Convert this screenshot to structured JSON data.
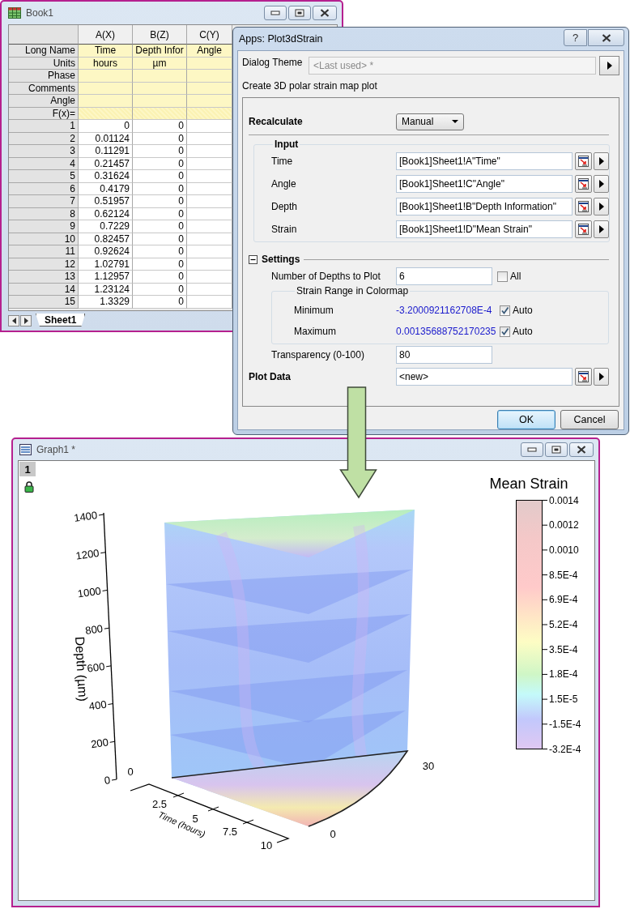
{
  "workbook": {
    "title": "Book1",
    "columns": [
      {
        "header": "A(X)",
        "long_name": "Time",
        "units": "hours"
      },
      {
        "header": "B(Z)",
        "long_name": "Depth Infor",
        "units": "µm"
      },
      {
        "header": "C(Y)",
        "long_name": "Angle"
      }
    ],
    "label_rows": [
      {
        "kind": "long_name",
        "text": "Long Name"
      },
      {
        "kind": "units",
        "text": "Units"
      },
      {
        "kind": "phase",
        "text": "Phase"
      },
      {
        "kind": "comments",
        "text": "Comments"
      },
      {
        "kind": "angle",
        "text": "Angle"
      },
      {
        "kind": "formula",
        "text": "F(x)="
      }
    ],
    "rows": [
      {
        "index": "1",
        "cells": [
          "0",
          "0"
        ]
      },
      {
        "index": "2",
        "cells": [
          "0.01124",
          "0"
        ]
      },
      {
        "index": "3",
        "cells": [
          "0.11291",
          "0"
        ]
      },
      {
        "index": "4",
        "cells": [
          "0.21457",
          "0"
        ]
      },
      {
        "index": "5",
        "cells": [
          "0.31624",
          "0"
        ]
      },
      {
        "index": "6",
        "cells": [
          "0.4179",
          "0"
        ]
      },
      {
        "index": "7",
        "cells": [
          "0.51957",
          "0"
        ]
      },
      {
        "index": "8",
        "cells": [
          "0.62124",
          "0"
        ]
      },
      {
        "index": "9",
        "cells": [
          "0.7229",
          "0"
        ]
      },
      {
        "index": "10",
        "cells": [
          "0.82457",
          "0"
        ]
      },
      {
        "index": "11",
        "cells": [
          "0.92624",
          "0"
        ]
      },
      {
        "index": "12",
        "cells": [
          "1.02791",
          "0"
        ]
      },
      {
        "index": "13",
        "cells": [
          "1.12957",
          "0"
        ]
      },
      {
        "index": "14",
        "cells": [
          "1.23124",
          "0"
        ]
      },
      {
        "index": "15",
        "cells": [
          "1.3329",
          "0"
        ]
      }
    ],
    "sheet_tab": "Sheet1"
  },
  "dialog": {
    "title": "Apps: Plot3dStrain",
    "help_button": "?",
    "theme": {
      "label": "Dialog Theme",
      "placeholder": "<Last used> *"
    },
    "description": "Create 3D polar strain map plot",
    "recalculate": {
      "label": "Recalculate",
      "value": "Manual"
    },
    "input_group": {
      "title": "Input",
      "fields": [
        {
          "label": "Time",
          "value": "[Book1]Sheet1!A\"Time\""
        },
        {
          "label": "Angle",
          "value": "[Book1]Sheet1!C\"Angle\""
        },
        {
          "label": "Depth",
          "value": "[Book1]Sheet1!B\"Depth Information\""
        },
        {
          "label": "Strain",
          "value": "[Book1]Sheet1!D\"Mean Strain\""
        }
      ]
    },
    "settings": {
      "title": "Settings",
      "expanded": true,
      "depths": {
        "label": "Number of Depths to Plot",
        "value": "6",
        "all_label": "All",
        "all_checked": false
      },
      "strain_range": {
        "title": "Strain Range in Colormap",
        "rows": [
          {
            "label": "Minimum",
            "value": "-3.2000921162708E-4",
            "auto_label": "Auto",
            "auto_checked": true
          },
          {
            "label": "Maximum",
            "value": "0.00135688752170235",
            "auto_label": "Auto",
            "auto_checked": true
          }
        ]
      },
      "transparency": {
        "label": "Transparency (0-100)",
        "value": "80"
      }
    },
    "plot_data": {
      "label": "Plot Data",
      "value": "<new>"
    },
    "buttons": [
      {
        "label": "OK",
        "default": true
      },
      {
        "label": "Cancel",
        "default": false
      }
    ]
  },
  "graph": {
    "title": "Graph1 *",
    "layer": "1",
    "depth_axis": {
      "title": "Depth (µm)",
      "ticks": [
        "1400",
        "1200",
        "1000",
        "800",
        "600",
        "400",
        "200",
        "0"
      ]
    },
    "time_axis": {
      "title": "Time (hours)",
      "ticks": [
        "0",
        "2.5",
        "5",
        "7.5",
        "10"
      ]
    },
    "angle_ticks": [
      "0",
      "30"
    ],
    "legend": {
      "title": "Mean Strain",
      "ticks": [
        "0.0014",
        "0.0012",
        "0.0010",
        "8.5E-4",
        "6.9E-4",
        "5.2E-4",
        "3.5E-4",
        "1.8E-4",
        "1.5E-5",
        "-1.5E-4",
        "-3.2E-4"
      ]
    }
  }
}
